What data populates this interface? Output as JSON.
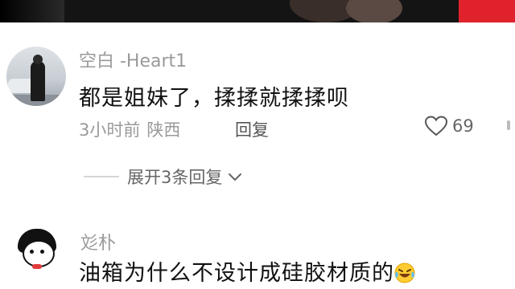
{
  "comments": [
    {
      "username": "空白 -Heart1",
      "text": "都是姐妹了，揉揉就揉揉呗",
      "time": "3小时前",
      "location": "陕西",
      "reply_label": "回复",
      "likes": "69",
      "expand_label": "展开3条回复"
    },
    {
      "username": "彣朴",
      "text": "油箱为什么不设计成硅胶材质的"
    }
  ],
  "icons": {
    "like": "heart-outline-icon",
    "expand": "chevron-down-icon",
    "emoji": "laughing-tears-emoji"
  },
  "colors": {
    "accent_red": "#e0222c",
    "meta_gray": "#9a9a9a",
    "text_dark": "#111111"
  }
}
